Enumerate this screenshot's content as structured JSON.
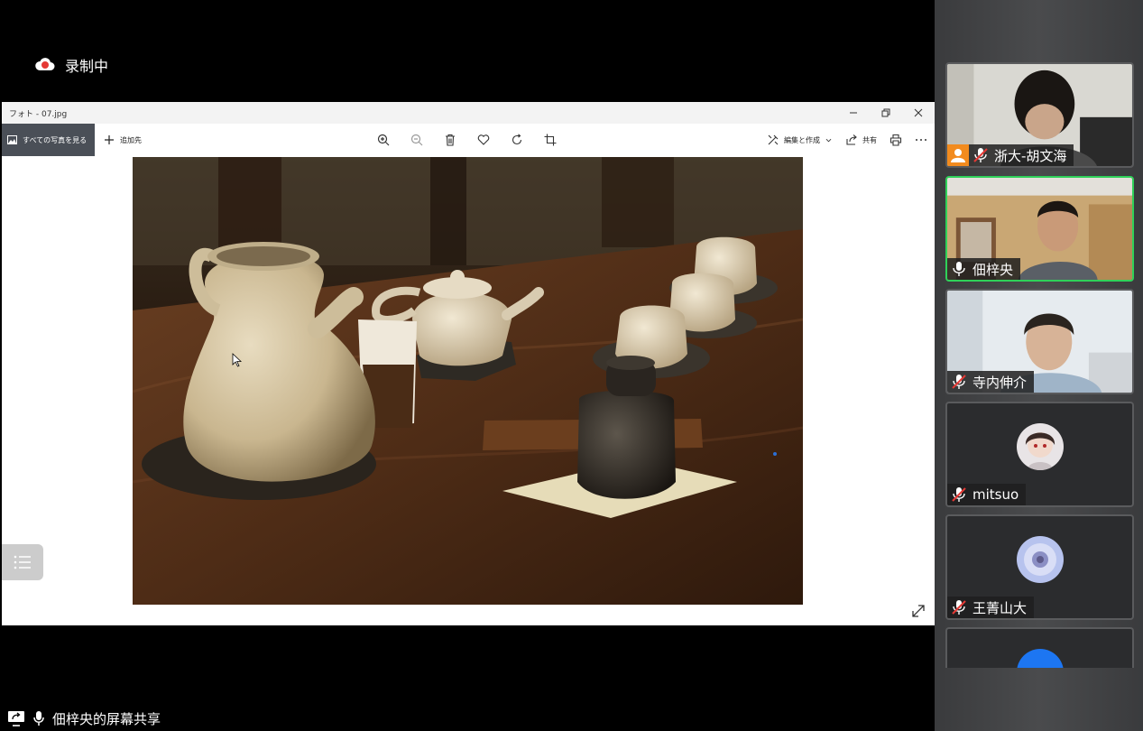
{
  "recording": {
    "label": "录制中",
    "icon": "cloud-record-icon",
    "color": "#e53935"
  },
  "photo_window": {
    "title": "フォト - 07.jpg",
    "all_photos_label": "すべての写真を見る",
    "add_to_label": "追加先",
    "edit_create_label": "編集と作成",
    "share_label": "共有"
  },
  "screen_share": {
    "label": "佃梓央的屏幕共享"
  },
  "participants": [
    {
      "name": "浙大-胡文海",
      "muted": true,
      "host": true,
      "type": "video"
    },
    {
      "name": "佃梓央",
      "muted": false,
      "host": false,
      "type": "video",
      "speaking": true
    },
    {
      "name": "寺内伸介",
      "muted": true,
      "host": false,
      "type": "video"
    },
    {
      "name": "mitsuo",
      "muted": true,
      "host": false,
      "type": "avatar"
    },
    {
      "name": "王菁山大",
      "muted": true,
      "host": false,
      "type": "avatar"
    },
    {
      "name": "",
      "muted": true,
      "host": false,
      "type": "avatar-partial"
    }
  ],
  "colors": {
    "speaking_border": "#2fd159",
    "host_badge": "#f28b1e",
    "avatar_blue": "#1d76f2"
  }
}
